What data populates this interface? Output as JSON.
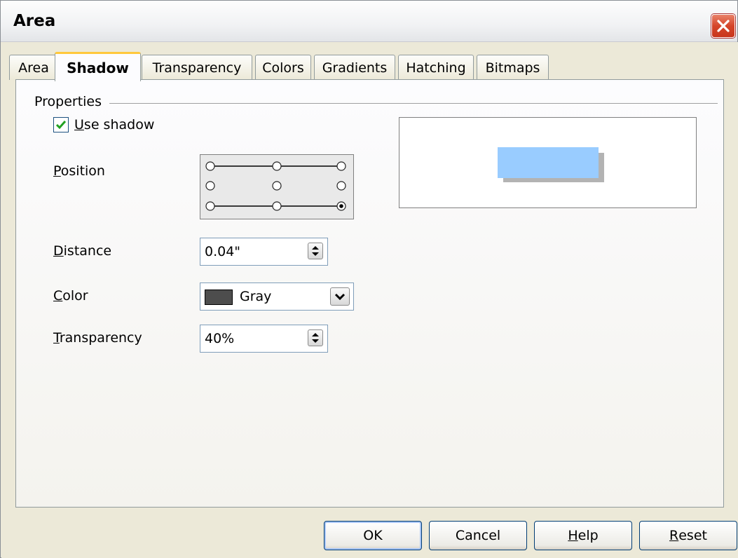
{
  "window": {
    "title": "Area"
  },
  "tabs": [
    {
      "label": "Area"
    },
    {
      "label": "Shadow"
    },
    {
      "label": "Transparency"
    },
    {
      "label": "Colors"
    },
    {
      "label": "Gradients"
    },
    {
      "label": "Hatching"
    },
    {
      "label": "Bitmaps"
    }
  ],
  "properties": {
    "section_label": "Properties",
    "use_shadow": {
      "first": "U",
      "rest": "se shadow",
      "checked": true
    },
    "position": {
      "first": "P",
      "rest": "osition",
      "selected": "bottom-right"
    },
    "distance": {
      "first": "D",
      "rest": "istance",
      "value": "0.04\""
    },
    "color": {
      "first": "C",
      "rest": "olor",
      "value": "Gray",
      "swatch": "#4d4d4d"
    },
    "transparency": {
      "first": "T",
      "rest": "ransparency",
      "value": "40%"
    }
  },
  "preview": {
    "object_color": "#99ccff",
    "shadow_color": "#b3b3b3"
  },
  "buttons": {
    "ok": "OK",
    "cancel": "Cancel",
    "help": {
      "first": "H",
      "rest": "elp"
    },
    "reset": {
      "first": "R",
      "rest": "eset"
    }
  },
  "icons": [
    "close-icon",
    "checkmark-icon",
    "spin-arrows-icon",
    "dropdown-arrow-icon"
  ]
}
